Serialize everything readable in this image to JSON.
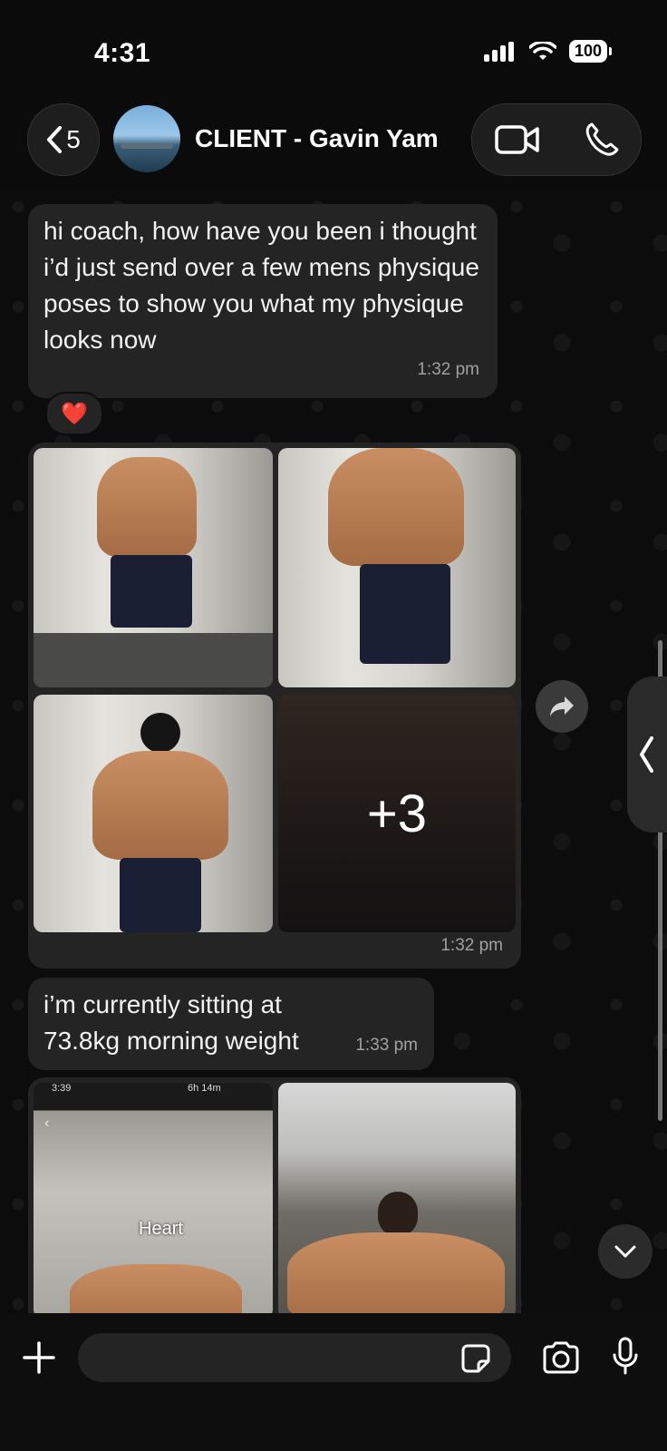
{
  "status_bar": {
    "time": "4:31",
    "battery": "100"
  },
  "header": {
    "back_count": "5",
    "contact_name": "CLIENT - Gavin Yam"
  },
  "messages": [
    {
      "text": "hi coach, how have you been  i thought i’d just send over a few mens physique poses to show you what my physique looks now",
      "time": "1:32 pm",
      "reaction": "❤️"
    },
    {
      "type": "album",
      "more_count": "+3",
      "time": "1:32 pm"
    },
    {
      "text": "i’m currently sitting at 73.8kg morning weight",
      "time": "1:33 pm"
    },
    {
      "type": "album",
      "photo_overlay_time": "3:39",
      "photo_overlay_timer": "6h 14m",
      "photo_caption": "Heart"
    }
  ],
  "icons": {
    "back": "chevron-left-icon",
    "video": "video-camera-icon",
    "call": "phone-icon",
    "forward": "forward-arrow-icon",
    "side": "chevron-left-icon",
    "down": "chevron-down-icon",
    "attach": "plus-icon",
    "sticker": "sticker-icon",
    "camera": "camera-icon",
    "mic": "microphone-icon"
  },
  "colors": {
    "bubble": "#242424",
    "background": "#0c0c0c",
    "heart": "#e5233b"
  }
}
